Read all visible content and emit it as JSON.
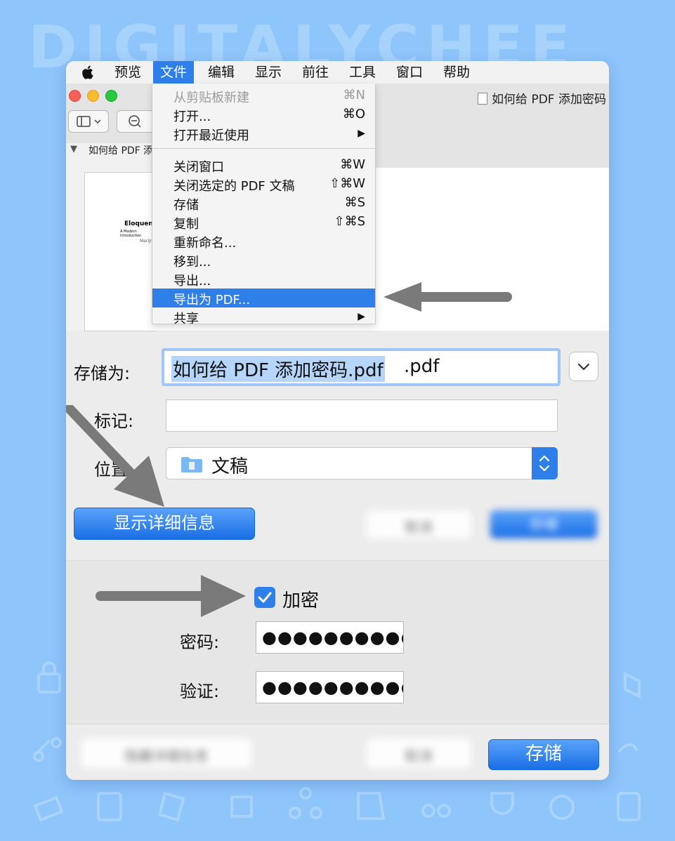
{
  "watermark": "DIGITALYCHEE",
  "menubar": {
    "items": [
      "预览",
      "文件",
      "编辑",
      "显示",
      "前往",
      "工具",
      "窗口",
      "帮助"
    ],
    "active_index": 1
  },
  "window": {
    "title": "如何给 PDF 添加密码",
    "sidebar_item": "如何给 PDF 添加密码",
    "thumbnail": {
      "title": "Eloquent",
      "subtitle": "A Modern Introduction",
      "author": "Marijn"
    }
  },
  "file_menu": {
    "items": [
      {
        "label": "从剪贴板新建",
        "shortcut": "⌘N",
        "disabled": true
      },
      {
        "label": "打开...",
        "shortcut": "⌘O"
      },
      {
        "label": "打开最近使用",
        "shortcut": "▶"
      },
      {
        "label": "关闭窗口",
        "shortcut": "⌘W"
      },
      {
        "label": "关闭选定的 PDF 文稿",
        "shortcut": "⇧⌘W"
      },
      {
        "label": "存储",
        "shortcut": "⌘S"
      },
      {
        "label": "复制",
        "shortcut": "⇧⌘S"
      },
      {
        "label": "重新命名...",
        "shortcut": ""
      },
      {
        "label": "移到...",
        "shortcut": ""
      },
      {
        "label": "导出...",
        "shortcut": ""
      },
      {
        "label": "导出为 PDF...",
        "shortcut": "",
        "highlighted": true
      },
      {
        "label": "共享",
        "shortcut": "▶"
      }
    ]
  },
  "save_dialog": {
    "save_as_label": "存储为:",
    "filename_selected": "如何给 PDF 添加密码.pdf",
    "filename_rest": ".pdf",
    "tags_label": "标记:",
    "tags_value": "",
    "location_label": "位置:",
    "location_value": "文稿",
    "show_details_label": "显示详细信息",
    "cancel_label": "取消",
    "save_label": "存储"
  },
  "encryption": {
    "checkbox_label": "加密",
    "checked": true,
    "password_label": "密码:",
    "password_value": "●●●●●●●●●●●",
    "verify_label": "验证:",
    "verify_value": "●●●●●●●●●●●"
  },
  "footer": {
    "hide_details_label": "隐藏详细信息",
    "cancel_label": "取消",
    "save_label": "存储"
  },
  "colors": {
    "background": "#8ec5fb",
    "accent": "#2f7fea",
    "annotation_arrow": "#7a7a7a"
  }
}
